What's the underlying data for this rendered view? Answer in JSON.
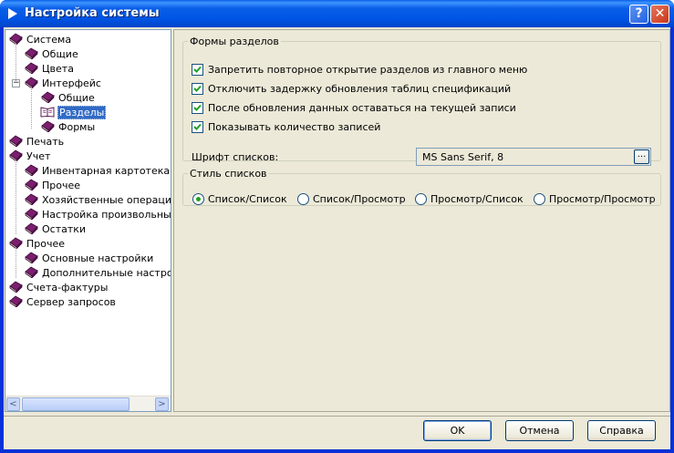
{
  "window": {
    "title": "Настройка системы",
    "help_glyph": "?",
    "close_glyph": "✕"
  },
  "tree": {
    "nodes": [
      {
        "label": "Система",
        "level": 0,
        "icon": "book-icon"
      },
      {
        "label": "Общие",
        "level": 1,
        "icon": "book-icon"
      },
      {
        "label": "Цвета",
        "level": 1,
        "icon": "book-icon"
      },
      {
        "label": "Интерфейс",
        "level": 1,
        "icon": "book-icon",
        "expander": "−"
      },
      {
        "label": "Общие",
        "level": 2,
        "icon": "book-icon"
      },
      {
        "label": "Разделы",
        "level": 2,
        "icon": "open-book-icon",
        "selected": true
      },
      {
        "label": "Формы",
        "level": 2,
        "icon": "book-icon"
      },
      {
        "label": "Печать",
        "level": 0,
        "icon": "book-icon"
      },
      {
        "label": "Учет",
        "level": 0,
        "icon": "book-icon"
      },
      {
        "label": "Инвентарная картотека",
        "level": 1,
        "icon": "book-icon"
      },
      {
        "label": "Прочее",
        "level": 1,
        "icon": "book-icon"
      },
      {
        "label": "Хозяйственные операции",
        "level": 1,
        "icon": "book-icon"
      },
      {
        "label": "Настройка произвольных д",
        "level": 1,
        "icon": "book-icon"
      },
      {
        "label": "Остатки",
        "level": 1,
        "icon": "book-icon"
      },
      {
        "label": "Прочее",
        "level": 0,
        "icon": "book-icon"
      },
      {
        "label": "Основные настройки",
        "level": 1,
        "icon": "book-icon"
      },
      {
        "label": "Дополнительные настройк",
        "level": 1,
        "icon": "book-icon"
      },
      {
        "label": "Счета-фактуры",
        "level": 0,
        "icon": "book-icon"
      },
      {
        "label": "Сервер запросов",
        "level": 0,
        "icon": "book-icon"
      }
    ],
    "scroll_left": "<",
    "scroll_right": ">"
  },
  "forms_group": {
    "legend": "Формы разделов",
    "checkboxes": [
      {
        "label": "Запретить повторное открытие разделов из главного меню",
        "checked": true
      },
      {
        "label": "Отключить задержку обновления таблиц спецификаций",
        "checked": true
      },
      {
        "label": "После обновления данных оставаться на текущей записи",
        "checked": true
      },
      {
        "label": "Показывать количество записей",
        "checked": true
      }
    ],
    "font_label": "Шрифт списков:",
    "font_value": "MS Sans Serif, 8",
    "font_button": "..."
  },
  "style_group": {
    "legend": "Стиль списков",
    "options": [
      {
        "label": "Список/Список",
        "selected": true
      },
      {
        "label": "Список/Просмотр",
        "selected": false
      },
      {
        "label": "Просмотр/Список",
        "selected": false
      },
      {
        "label": "Просмотр/Просмотр",
        "selected": false
      }
    ]
  },
  "buttons": {
    "ok": "OK",
    "cancel": "Отмена",
    "help": "Справка"
  },
  "colors": {
    "titlebar": "#0054e3",
    "selection": "#316ac5",
    "dialog_bg": "#ece9d8",
    "book": "#7a1f6e",
    "check": "#21a121"
  }
}
